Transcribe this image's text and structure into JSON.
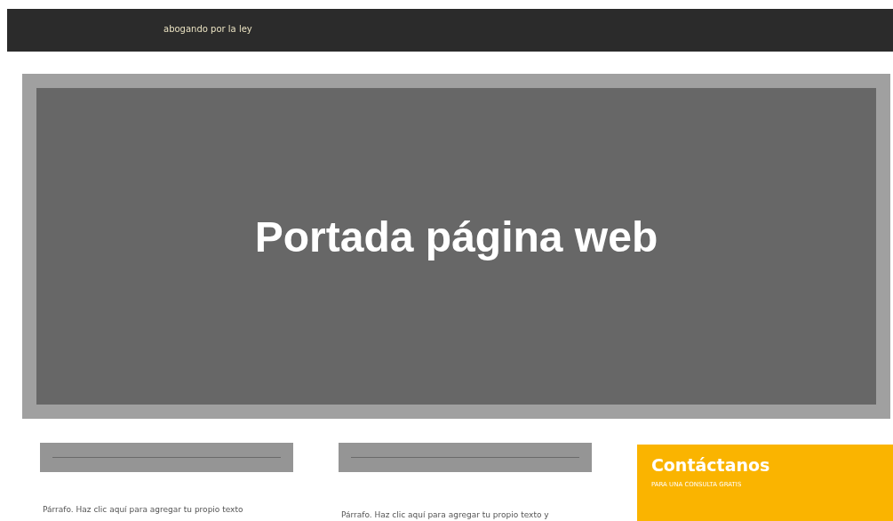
{
  "header": {
    "tagline": "abogando por la ley"
  },
  "hero": {
    "title": "Portada página web"
  },
  "columns": [
    {
      "paragraph": "Párrafo. Haz clic aquí para agregar tu propio texto"
    },
    {
      "paragraph": "Párrafo. Haz clic aquí para agregar tu propio texto y"
    }
  ],
  "contact": {
    "title": "Contáctanos",
    "subtitle": "PARA UNA CONSULTA GRATIS"
  }
}
